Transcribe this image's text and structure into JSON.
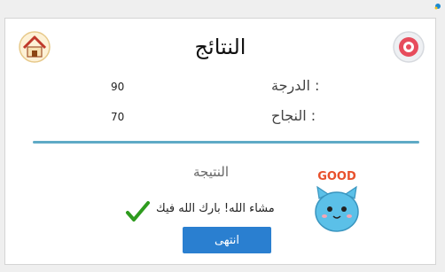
{
  "header": {
    "title": "النتائج"
  },
  "stats": [
    {
      "label": "الدرجة :",
      "value": "90"
    },
    {
      "label": "النجاح :",
      "value": "70"
    }
  ],
  "result": {
    "label": "النتيجة",
    "message": "مشاء الله! بارك الله فيك",
    "mascot_text": "GOOD"
  },
  "actions": {
    "done_label": "انتهى"
  },
  "colors": {
    "accent": "#5eaac6",
    "button": "#2a7fd0",
    "check": "#2e9b1e"
  },
  "icons": {
    "home": "home-icon",
    "settings": "settings-icon",
    "check": "check-icon",
    "mascot": "mascot-icon"
  }
}
